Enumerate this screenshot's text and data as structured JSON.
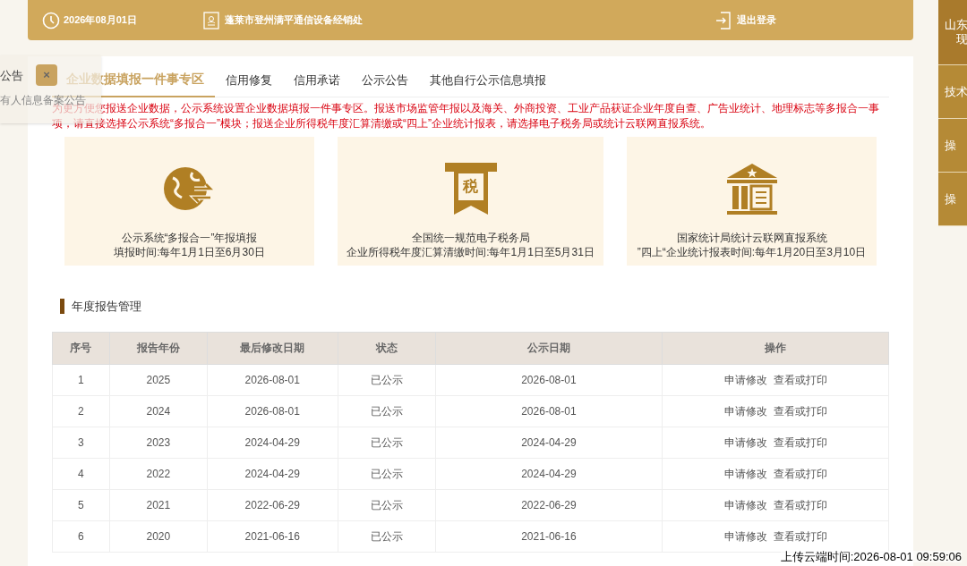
{
  "header": {
    "date": "2026年08月01日",
    "company": "蓬莱市登州满平通信设备经销处",
    "logout": "退出登录"
  },
  "side_tabs": [
    {
      "lines": [
        "山东",
        "现"
      ],
      "selected": true
    },
    {
      "lines": [
        "技术"
      ],
      "selected": false
    },
    {
      "lines": [
        "操"
      ],
      "selected": false
    },
    {
      "lines": [
        "操"
      ],
      "selected": false
    }
  ],
  "tabs": [
    {
      "label": "企业数据填报一件事专区",
      "selected": true
    },
    {
      "label": "信用修复",
      "selected": false
    },
    {
      "label": "信用承诺",
      "selected": false
    },
    {
      "label": "公示公告",
      "selected": false
    },
    {
      "label": "其他自行公示信息填报",
      "selected": false
    }
  ],
  "notice": "为更方便您报送企业数据，公示系统设置企业数据填报一件事专区。报送市场监管年报以及海关、外商投资、工业产品获证企业年度自查、广告业统计、地理标志等多报合一事项，请直接选择公示系统“多报合一”模块；报送企业所得税年度汇算清缴或“四上”企业统计报表，请选择电子税务局或统计云联网直报系统。",
  "cards": [
    {
      "kind": "globe",
      "title": "公示系统“多报合一”年报填报",
      "subtitle": "填报时间:每年1月1日至6月30日"
    },
    {
      "kind": "tax",
      "icon_text": "税",
      "title": "全国统一规范电子税务局",
      "subtitle": "企业所得税年度汇算清缴时间:每年1月1日至5月31日"
    },
    {
      "kind": "bank",
      "title": "国家统计局统计云联网直报系统",
      "subtitle": "”四上“企业统计报表时间:每年1月20日至3月10日"
    }
  ],
  "section_title": "年度报告管理",
  "table": {
    "columns": [
      "序号",
      "报告年份",
      "最后修改日期",
      "状态",
      "公示日期",
      "操作"
    ],
    "rows": [
      {
        "cells": [
          "1",
          "2025",
          "2026-08-01",
          "已公示",
          "2026-08-01"
        ],
        "actions": [
          "申请修改",
          "查看或打印"
        ]
      },
      {
        "cells": [
          "2",
          "2024",
          "2026-08-01",
          "已公示",
          "2026-08-01"
        ],
        "actions": [
          "申请修改",
          "查看或打印"
        ]
      },
      {
        "cells": [
          "3",
          "2023",
          "2024-04-29",
          "已公示",
          "2024-04-29"
        ],
        "actions": [
          "申请修改",
          "查看或打印"
        ]
      },
      {
        "cells": [
          "4",
          "2022",
          "2024-04-29",
          "已公示",
          "2024-04-29"
        ],
        "actions": [
          "申请修改",
          "查看或打印"
        ]
      },
      {
        "cells": [
          "5",
          "2021",
          "2022-06-29",
          "已公示",
          "2022-06-29"
        ],
        "actions": [
          "申请修改",
          "查看或打印"
        ]
      },
      {
        "cells": [
          "6",
          "2020",
          "2021-06-16",
          "已公示",
          "2021-06-16"
        ],
        "actions": [
          "申请修改",
          "查看或打印"
        ]
      }
    ]
  },
  "popup": {
    "title": "公告",
    "close": "×",
    "item": "有人信息备案公告"
  },
  "upload_time": "上传云端时间:2026-08-01 09:59:06"
}
